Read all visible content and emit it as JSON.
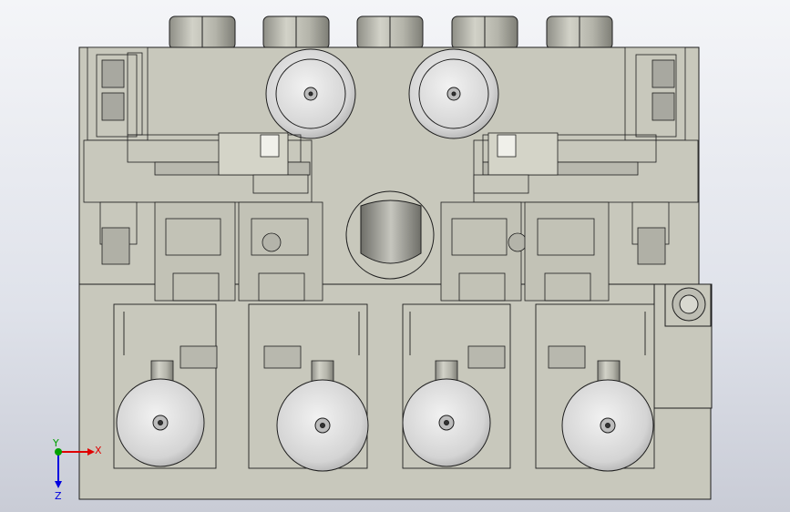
{
  "viewport": {
    "background_top": "#f4f5f8",
    "background_bottom": "#c9ccd6",
    "body_fill": "#c8c8bc",
    "edge_color": "#1e1e1e",
    "shaft_fill": "#d6d6d6"
  },
  "triad": {
    "x_label": "X",
    "y_label": "Y",
    "z_label": "Z",
    "x_color": "#e00000",
    "y_color": "#00a000",
    "z_color": "#0000e0"
  }
}
